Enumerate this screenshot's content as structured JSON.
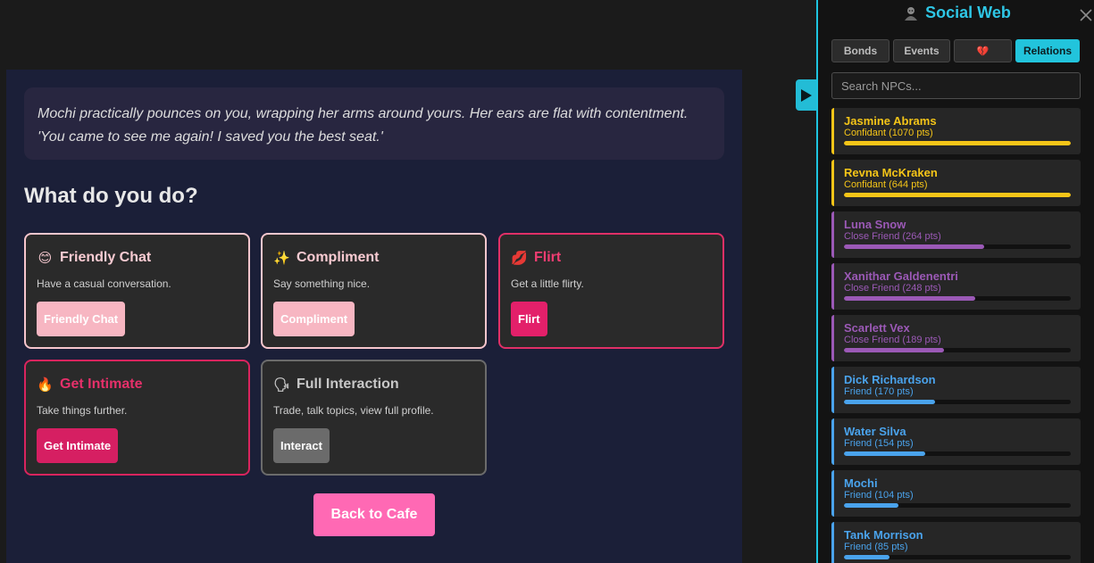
{
  "narration": "Mochi practically pounces on you, wrapping her arms around yours. Her ears are flat with contentment. 'You came to see me again! I saved you the best seat.'",
  "prompt": "What do you do?",
  "cards": [
    {
      "emoji": "😊",
      "title": "Friendly Chat",
      "desc": "Have a casual conversation.",
      "button": "Friendly Chat"
    },
    {
      "emoji": "✨",
      "title": "Compliment",
      "desc": "Say something nice.",
      "button": "Compliment"
    },
    {
      "emoji": "💋",
      "title": "Flirt",
      "desc": "Get a little flirty.",
      "button": "Flirt"
    },
    {
      "emoji": "🔥",
      "title": "Get Intimate",
      "desc": "Take things further.",
      "button": "Get Intimate"
    },
    {
      "emoji": "🗣",
      "title": "Full Interaction",
      "desc": "Trade, talk topics, view full profile.",
      "button": "Interact"
    }
  ],
  "back_button": "Back to Cafe",
  "sidebar": {
    "title": "Social Web",
    "tabs": [
      {
        "label": "Bonds"
      },
      {
        "label": "Events"
      },
      {
        "label": "💔"
      },
      {
        "label": "Relations",
        "active": true
      }
    ],
    "search_placeholder": "Search NPCs...",
    "npcs": [
      {
        "name": "Jasmine Abrams",
        "level": "Confidant (1070 pts)",
        "progress": 1.0,
        "color": "#f5c518"
      },
      {
        "name": "Revna McKraken",
        "level": "Confidant (644 pts)",
        "progress": 1.0,
        "color": "#f5c518"
      },
      {
        "name": "Luna Snow",
        "level": "Close Friend (264 pts)",
        "progress": 0.62,
        "color": "#9b59b6"
      },
      {
        "name": "Xanithar Galdenentri",
        "level": "Close Friend (248 pts)",
        "progress": 0.58,
        "color": "#9b59b6"
      },
      {
        "name": "Scarlett Vex",
        "level": "Close Friend (189 pts)",
        "progress": 0.44,
        "color": "#9b59b6"
      },
      {
        "name": "Dick Richardson",
        "level": "Friend (170 pts)",
        "progress": 0.4,
        "color": "#4aa3ec"
      },
      {
        "name": "Water Silva",
        "level": "Friend (154 pts)",
        "progress": 0.36,
        "color": "#4aa3ec"
      },
      {
        "name": "Mochi",
        "level": "Friend (104 pts)",
        "progress": 0.24,
        "color": "#4aa3ec"
      },
      {
        "name": "Tank Morrison",
        "level": "Friend (85 pts)",
        "progress": 0.2,
        "color": "#4aa3ec"
      }
    ]
  }
}
